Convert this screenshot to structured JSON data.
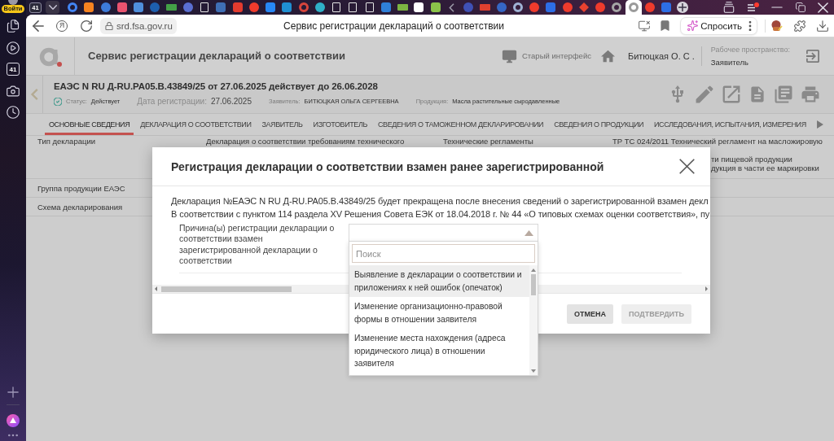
{
  "browser": {
    "profile_badge": "Войти",
    "sidebar_counter": "41",
    "tab_counter": "41",
    "tabs": [
      {
        "kind": "ring",
        "color": "#4285f4",
        "selected": false
      },
      {
        "kind": "square",
        "color": "#f58220",
        "selected": false
      },
      {
        "kind": "circle",
        "color": "#3d7bd9",
        "selected": false
      },
      {
        "kind": "square",
        "color": "#e9536f",
        "selected": false
      },
      {
        "kind": "square",
        "color": "#4f8fdc",
        "selected": false
      },
      {
        "kind": "circle",
        "color": "#1d5fae",
        "selected": false
      },
      {
        "kind": "bar",
        "color": "#43a047",
        "selected": false
      },
      {
        "kind": "circle",
        "color": "#5a6fd1",
        "selected": false
      },
      {
        "kind": "page",
        "color": "#e6e6e6",
        "selected": false
      },
      {
        "kind": "square",
        "color": "#3f6fb5",
        "selected": false
      },
      {
        "kind": "square",
        "color": "#e33b2e",
        "selected": false
      },
      {
        "kind": "circle",
        "color": "#ef3b2c",
        "selected": false
      },
      {
        "kind": "square",
        "color": "#2787f5",
        "selected": false
      },
      {
        "kind": "square",
        "color": "#1f8fd1",
        "selected": false
      },
      {
        "kind": "ring",
        "color": "#d8453c",
        "selected": false
      },
      {
        "kind": "circle",
        "color": "#2fb0c8",
        "selected": false
      },
      {
        "kind": "page",
        "color": "#e6e6e6",
        "selected": false
      },
      {
        "kind": "page",
        "color": "#e6e6e6",
        "selected": false
      },
      {
        "kind": "page",
        "color": "#e6e6e6",
        "selected": false
      },
      {
        "kind": "square",
        "color": "#2f7fd8",
        "selected": false
      },
      {
        "kind": "bar",
        "color": "#7cb342",
        "selected": false
      },
      {
        "kind": "square",
        "color": "#ffffff",
        "selected": false
      },
      {
        "kind": "square",
        "color": "#8bc34a",
        "selected": false
      },
      {
        "kind": "chevron",
        "color": "#9c9aa8",
        "selected": false
      },
      {
        "kind": "circle",
        "color": "#3f51b5",
        "selected": false
      },
      {
        "kind": "bar",
        "color": "#e0402f",
        "selected": false
      },
      {
        "kind": "circle",
        "color": "#3566c4",
        "selected": false
      },
      {
        "kind": "ring",
        "color": "#9fb2d4",
        "selected": false
      },
      {
        "kind": "circle",
        "color": "#ef3b2c",
        "selected": false
      },
      {
        "kind": "square",
        "color": "#2d6ee6",
        "selected": false
      },
      {
        "kind": "circle",
        "color": "#ef3b2c",
        "selected": false
      },
      {
        "kind": "diamond",
        "color": "#e8422f",
        "selected": false
      },
      {
        "kind": "circle",
        "color": "#ef3b2c",
        "selected": false
      },
      {
        "kind": "ring",
        "color": "#a5a5a5",
        "selected": false
      },
      {
        "kind": "ring",
        "color": "#9a9a9a",
        "selected": true
      },
      {
        "kind": "circle",
        "color": "#ef3b2c",
        "selected": false
      },
      {
        "kind": "square",
        "color": "#2d6ee6",
        "selected": false
      }
    ],
    "home_letter": "Я",
    "address": "srd.fsa.gov.ru",
    "page_title": "Сервис регистрации деклараций о соответствии",
    "ask_button": "Спросить"
  },
  "app_header": {
    "title": "Сервис регистрации деклараций о соответствии",
    "old_interface_link": "Старый интерфейс",
    "user_name": "Битюцкая О. С .",
    "workspace_label": "Рабочее пространство:",
    "workspace": "Заявитель"
  },
  "declaration": {
    "title": "ЕАЭС N RU Д-RU.PA05.B.43849/25 от 27.06.2025 действует до 26.06.2028",
    "details": [
      {
        "kind": "status",
        "label": "Статус:",
        "value": "Действует"
      },
      {
        "kind": "date",
        "label": "Дата регистрации:",
        "value": "27.06.2025"
      },
      {
        "kind": "text",
        "label": "Заявитель:",
        "value": "БИТЮЦКАЯ ОЛЬГА СЕРГЕЕВНА"
      },
      {
        "kind": "text",
        "label": "Продукция:",
        "value": "Масла растительные сыродавленные"
      }
    ]
  },
  "sections": [
    {
      "label": "ОСНОВНЫЕ СВЕДЕНИЯ",
      "selected": true
    },
    {
      "label": "ДЕКЛАРАЦИЯ О СООТВЕТСТВИИ",
      "selected": false
    },
    {
      "label": "ЗАЯВИТЕЛЬ",
      "selected": false
    },
    {
      "label": "ИЗГОТОВИТЕЛЬ",
      "selected": false
    },
    {
      "label": "СВЕДЕНИЯ О ТАМОЖЕННОМ ДЕКЛАРИРОВАНИИ",
      "selected": false
    },
    {
      "label": "СВЕДЕНИЯ О ПРОДУКЦИИ",
      "selected": false
    },
    {
      "label": "ИССЛЕДОВАНИЯ, ИСПЫТАНИЯ, ИЗМЕРЕНИЯ",
      "selected": false
    }
  ],
  "table": {
    "rows": [
      {
        "label": "Тип декларации",
        "value": "Декларация о соответствии требованиям технического",
        "column_3": "Технические регламенты",
        "column_4": [
          "ТР ТС 024/2011 Технический регламент на масложировую",
          "ти пищевой продукции",
          "дукция в части ее маркировки"
        ]
      },
      {
        "label": "Группа продукции ЕАЭС"
      },
      {
        "label": "Схема декларирования"
      }
    ]
  },
  "modal": {
    "title": "Регистрация декларации о соответствии взамен ранее зарегистрированной",
    "paragraphs": [
      "Декларация №ЕАЭС N RU Д-RU.PA05.B.43849/25 будет прекращена после внесения сведений о зарегистрированной взамен декл",
      "В соответствии с пунктом 114 раздела XV Решения Совета ЕЭК от 18.04.2018 г. № 44 «О типовых схемах оценки соответствия», пу"
    ],
    "field_label": "Причина(ы) регистрации декларации о соответствии взамен зарегистрированной декларации о соответствии",
    "dropdown": {
      "search_placeholder": "Поиск",
      "options": [
        {
          "label": "Выявление в декларации о соответствии и приложениях к ней ошибок (опечаток)",
          "highlighted": true
        },
        {
          "label": "Изменение организационно-правовой формы в отношении заявителя",
          "highlighted": false
        },
        {
          "label": "Изменение места нахождения (адреса юридического лица) в отношении заявителя",
          "highlighted": false
        }
      ]
    },
    "buttons": [
      {
        "label": "ОТМЕНА",
        "disabled": false
      },
      {
        "label": "ПОДТВЕРДИТЬ",
        "disabled": true
      }
    ]
  }
}
